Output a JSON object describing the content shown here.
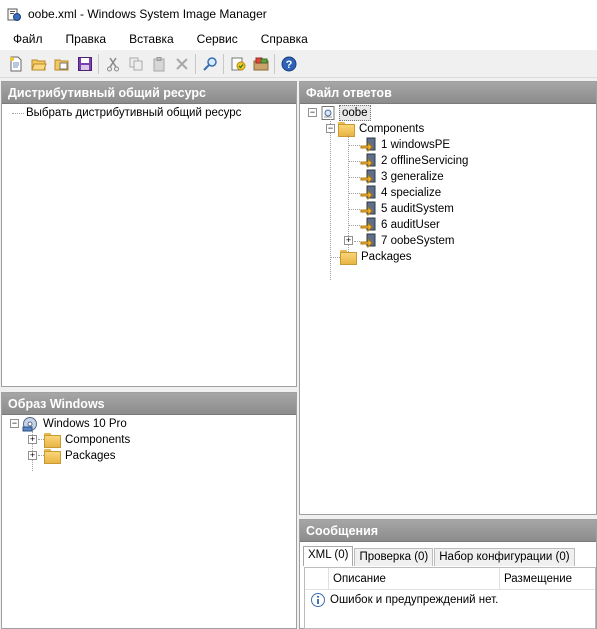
{
  "window": {
    "title": "oobe.xml - Windows System Image Manager"
  },
  "menu": [
    "Файл",
    "Правка",
    "Вставка",
    "Сервис",
    "Справка"
  ],
  "toolbar_icons": [
    "new-file-icon",
    "open-folder-icon",
    "open-answer-icon",
    "save-icon",
    "cut-icon",
    "copy-icon",
    "paste-icon",
    "delete-icon",
    "find-icon",
    "validate-icon",
    "config-set-icon",
    "help-icon"
  ],
  "distribution": {
    "header": "Дистрибутивный общий ресурс",
    "item": "Выбрать дистрибутивный общий ресурс"
  },
  "image": {
    "header": "Образ Windows",
    "root": "Windows 10 Pro",
    "children": [
      "Components",
      "Packages"
    ]
  },
  "answer": {
    "header": "Файл ответов",
    "root": "oobe",
    "components": "Components",
    "passes": [
      "1 windowsPE",
      "2 offlineServicing",
      "3 generalize",
      "4 specialize",
      "5 auditSystem",
      "6 auditUser",
      "7 oobeSystem"
    ],
    "packages": "Packages"
  },
  "messages": {
    "header": "Сообщения",
    "tabs": [
      "XML (0)",
      "Проверка (0)",
      "Набор конфигурации (0)"
    ],
    "columns": [
      "Описание",
      "Размещение"
    ],
    "row": "Ошибок и предупреждений нет."
  },
  "colors": {
    "header_bg": "#959595",
    "folder": "#f5c85e",
    "accent": "#2d6fd8"
  }
}
